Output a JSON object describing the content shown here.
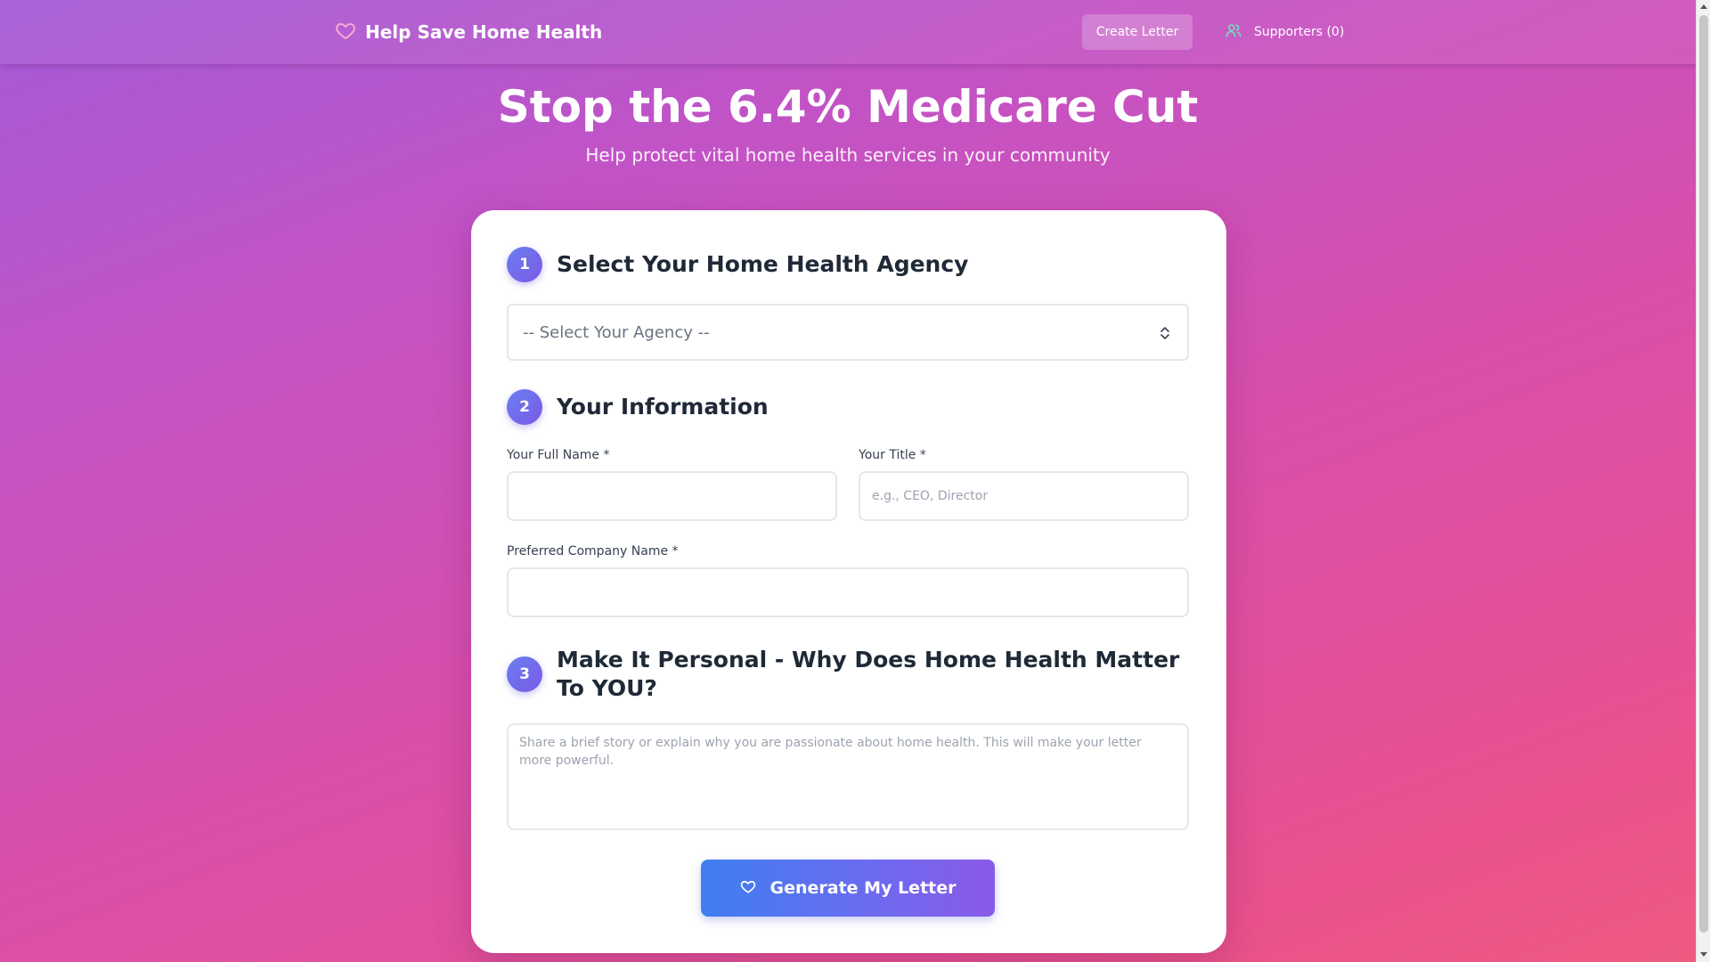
{
  "nav": {
    "brand_title": "Help Save Home Health",
    "brand_icon": "heart-icon",
    "create_letter_label": "Create Letter",
    "supporters_label": "Supporters (0)",
    "supporters_icon": "users-icon"
  },
  "hero": {
    "title": "Stop the 6.4% Medicare Cut",
    "subtitle": "Help protect vital home health services in your community"
  },
  "form": {
    "step1": {
      "number": "1",
      "title": "Select Your Home Health Agency",
      "select_value": "-- Select Your Agency --"
    },
    "step2": {
      "number": "2",
      "title": "Your Information",
      "full_name_label": "Your Full Name *",
      "full_name_value": "",
      "title_label": "Your Title *",
      "title_placeholder": "e.g., CEO, Director",
      "company_label": "Preferred Company Name *",
      "company_value": ""
    },
    "step3": {
      "number": "3",
      "title": "Make It Personal - Why Does Home Health Matter To YOU?",
      "story_placeholder": "Share a brief story or explain why you are passionate about home health. This will make your letter more powerful."
    },
    "generate_label": "Generate My Letter"
  },
  "colors": {
    "accent_badge": "#6a7ef0",
    "heart_icon": "#f9a8d4",
    "users_icon": "#6ee7b7",
    "button_gradient_start": "#3f7ef0",
    "button_gradient_end": "#8a5ae8"
  }
}
